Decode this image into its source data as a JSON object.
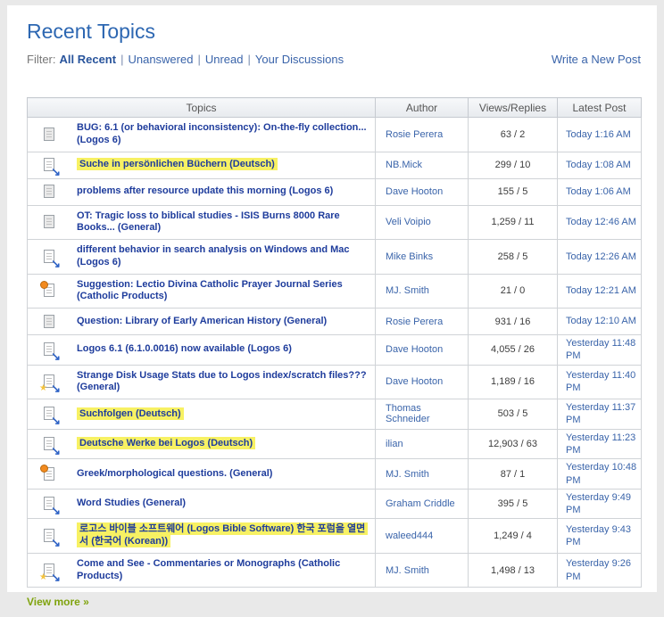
{
  "header": {
    "title": "Recent Topics"
  },
  "filter": {
    "label": "Filter:",
    "separator": "|",
    "options": [
      "All Recent",
      "Unanswered",
      "Unread",
      "Your Discussions"
    ],
    "write_new_post": "Write a New Post"
  },
  "table": {
    "headers": [
      "Topics",
      "Author",
      "Views/Replies",
      "Latest Post"
    ],
    "rows": [
      {
        "icon": "read-topic-icon",
        "title": "BUG: 6.1 (or behavioral inconsistency): On-the-fly collection...",
        "forum": "(Logos 6)",
        "highlighted": false,
        "author": "Rosie Perera",
        "views_replies": "63 / 2",
        "latest_post": "Today 1:16 AM"
      },
      {
        "icon": "unread-topic-icon",
        "title": "Suche in persönlichen Büchern",
        "forum": "(Deutsch)",
        "highlighted": true,
        "author": "NB.Mick",
        "views_replies": "299 / 10",
        "latest_post": "Today 1:08 AM"
      },
      {
        "icon": "read-topic-icon",
        "title": "problems after resource update this morning",
        "forum": "(Logos 6)",
        "highlighted": false,
        "author": "Dave Hooton",
        "views_replies": "155 / 5",
        "latest_post": "Today 1:06 AM"
      },
      {
        "icon": "read-topic-icon",
        "title": "OT: Tragic loss to biblical studies - ISIS Burns 8000 Rare Books...",
        "forum": "(General)",
        "highlighted": false,
        "author": "Veli Voipio",
        "views_replies": "1,259 / 11",
        "latest_post": "Today 12:46 AM"
      },
      {
        "icon": "unread-topic-icon",
        "title": "different behavior in search analysis on Windows and Mac",
        "forum": "(Logos 6)",
        "highlighted": false,
        "author": "Mike Binks",
        "views_replies": "258 / 5",
        "latest_post": "Today 12:26 AM"
      },
      {
        "icon": "announcement-topic-icon",
        "title": "Suggestion: Lectio Divina Catholic Prayer Journal Series",
        "forum": "(Catholic Products)",
        "highlighted": false,
        "author": "MJ. Smith",
        "views_replies": "21 / 0",
        "latest_post": "Today 12:21 AM"
      },
      {
        "icon": "read-topic-icon",
        "title": "Question: Library of Early American History",
        "forum": "(General)",
        "highlighted": false,
        "author": "Rosie Perera",
        "views_replies": "931 / 16",
        "latest_post": "Today 12:10 AM"
      },
      {
        "icon": "unread-topic-icon",
        "title": "Logos 6.1 (6.1.0.0016) now available",
        "forum": "(Logos 6)",
        "highlighted": false,
        "author": "Dave Hooton",
        "views_replies": "4,055 / 26",
        "latest_post": "Yesterday 11:48 PM"
      },
      {
        "icon": "unread-starred-topic-icon",
        "title": "Strange Disk Usage Stats due to Logos index/scratch files???",
        "forum": "(General)",
        "highlighted": false,
        "author": "Dave Hooton",
        "views_replies": "1,189 / 16",
        "latest_post": "Yesterday 11:40 PM"
      },
      {
        "icon": "unread-topic-icon",
        "title": "Suchfolgen",
        "forum": "(Deutsch)",
        "highlighted": true,
        "author": "Thomas Schneider",
        "views_replies": "503 / 5",
        "latest_post": "Yesterday 11:37 PM"
      },
      {
        "icon": "unread-topic-icon",
        "title": "Deutsche Werke bei Logos",
        "forum": "(Deutsch)",
        "highlighted": true,
        "author": "ilian",
        "views_replies": "12,903 / 63",
        "latest_post": "Yesterday 11:23 PM"
      },
      {
        "icon": "announcement-topic-icon",
        "title": "Greek/morphological questions.",
        "forum": "(General)",
        "highlighted": false,
        "author": "MJ. Smith",
        "views_replies": "87 / 1",
        "latest_post": "Yesterday 10:48 PM"
      },
      {
        "icon": "unread-topic-icon",
        "title": "Word Studies",
        "forum": "(General)",
        "highlighted": false,
        "author": "Graham Criddle",
        "views_replies": "395 / 5",
        "latest_post": "Yesterday 9:49 PM"
      },
      {
        "icon": "unread-topic-icon",
        "title": "로고스 바이블 소프트웨어 (Logos Bible Software) 한국 포럼을 열면서",
        "forum": "(한국어 (Korean))",
        "highlighted": true,
        "author": "waleed444",
        "views_replies": "1,249 / 4",
        "latest_post": "Yesterday 9:43 PM"
      },
      {
        "icon": "unread-starred-topic-icon",
        "title": "Come and See - Commentaries or Monographs",
        "forum": "(Catholic Products)",
        "highlighted": false,
        "author": "MJ. Smith",
        "views_replies": "1,498 / 13",
        "latest_post": "Yesterday 9:26 PM"
      }
    ]
  },
  "footer": {
    "view_more": "View more »"
  },
  "colors": {
    "accent_blue": "#2d67b2",
    "topic_link_blue": "#1e3c9c",
    "meta_link_blue": "#3a64aa",
    "highlight_yellow": "#f7f163",
    "view_more_green": "#7fa30d"
  }
}
